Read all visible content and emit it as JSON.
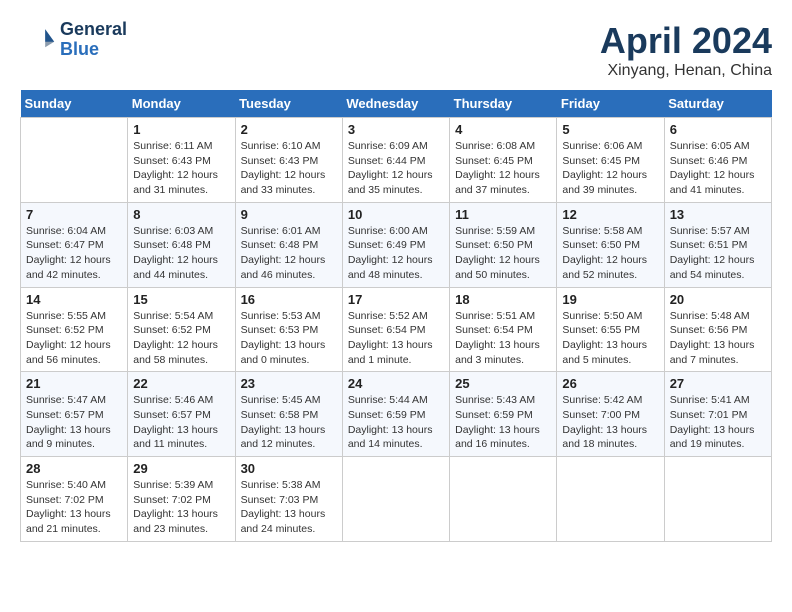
{
  "header": {
    "logo_line1": "General",
    "logo_line2": "Blue",
    "month": "April 2024",
    "location": "Xinyang, Henan, China"
  },
  "days_of_week": [
    "Sunday",
    "Monday",
    "Tuesday",
    "Wednesday",
    "Thursday",
    "Friday",
    "Saturday"
  ],
  "weeks": [
    [
      {
        "day": "",
        "sunrise": "",
        "sunset": "",
        "daylight": ""
      },
      {
        "day": "1",
        "sunrise": "Sunrise: 6:11 AM",
        "sunset": "Sunset: 6:43 PM",
        "daylight": "Daylight: 12 hours and 31 minutes."
      },
      {
        "day": "2",
        "sunrise": "Sunrise: 6:10 AM",
        "sunset": "Sunset: 6:43 PM",
        "daylight": "Daylight: 12 hours and 33 minutes."
      },
      {
        "day": "3",
        "sunrise": "Sunrise: 6:09 AM",
        "sunset": "Sunset: 6:44 PM",
        "daylight": "Daylight: 12 hours and 35 minutes."
      },
      {
        "day": "4",
        "sunrise": "Sunrise: 6:08 AM",
        "sunset": "Sunset: 6:45 PM",
        "daylight": "Daylight: 12 hours and 37 minutes."
      },
      {
        "day": "5",
        "sunrise": "Sunrise: 6:06 AM",
        "sunset": "Sunset: 6:45 PM",
        "daylight": "Daylight: 12 hours and 39 minutes."
      },
      {
        "day": "6",
        "sunrise": "Sunrise: 6:05 AM",
        "sunset": "Sunset: 6:46 PM",
        "daylight": "Daylight: 12 hours and 41 minutes."
      }
    ],
    [
      {
        "day": "7",
        "sunrise": "Sunrise: 6:04 AM",
        "sunset": "Sunset: 6:47 PM",
        "daylight": "Daylight: 12 hours and 42 minutes."
      },
      {
        "day": "8",
        "sunrise": "Sunrise: 6:03 AM",
        "sunset": "Sunset: 6:48 PM",
        "daylight": "Daylight: 12 hours and 44 minutes."
      },
      {
        "day": "9",
        "sunrise": "Sunrise: 6:01 AM",
        "sunset": "Sunset: 6:48 PM",
        "daylight": "Daylight: 12 hours and 46 minutes."
      },
      {
        "day": "10",
        "sunrise": "Sunrise: 6:00 AM",
        "sunset": "Sunset: 6:49 PM",
        "daylight": "Daylight: 12 hours and 48 minutes."
      },
      {
        "day": "11",
        "sunrise": "Sunrise: 5:59 AM",
        "sunset": "Sunset: 6:50 PM",
        "daylight": "Daylight: 12 hours and 50 minutes."
      },
      {
        "day": "12",
        "sunrise": "Sunrise: 5:58 AM",
        "sunset": "Sunset: 6:50 PM",
        "daylight": "Daylight: 12 hours and 52 minutes."
      },
      {
        "day": "13",
        "sunrise": "Sunrise: 5:57 AM",
        "sunset": "Sunset: 6:51 PM",
        "daylight": "Daylight: 12 hours and 54 minutes."
      }
    ],
    [
      {
        "day": "14",
        "sunrise": "Sunrise: 5:55 AM",
        "sunset": "Sunset: 6:52 PM",
        "daylight": "Daylight: 12 hours and 56 minutes."
      },
      {
        "day": "15",
        "sunrise": "Sunrise: 5:54 AM",
        "sunset": "Sunset: 6:52 PM",
        "daylight": "Daylight: 12 hours and 58 minutes."
      },
      {
        "day": "16",
        "sunrise": "Sunrise: 5:53 AM",
        "sunset": "Sunset: 6:53 PM",
        "daylight": "Daylight: 13 hours and 0 minutes."
      },
      {
        "day": "17",
        "sunrise": "Sunrise: 5:52 AM",
        "sunset": "Sunset: 6:54 PM",
        "daylight": "Daylight: 13 hours and 1 minute."
      },
      {
        "day": "18",
        "sunrise": "Sunrise: 5:51 AM",
        "sunset": "Sunset: 6:54 PM",
        "daylight": "Daylight: 13 hours and 3 minutes."
      },
      {
        "day": "19",
        "sunrise": "Sunrise: 5:50 AM",
        "sunset": "Sunset: 6:55 PM",
        "daylight": "Daylight: 13 hours and 5 minutes."
      },
      {
        "day": "20",
        "sunrise": "Sunrise: 5:48 AM",
        "sunset": "Sunset: 6:56 PM",
        "daylight": "Daylight: 13 hours and 7 minutes."
      }
    ],
    [
      {
        "day": "21",
        "sunrise": "Sunrise: 5:47 AM",
        "sunset": "Sunset: 6:57 PM",
        "daylight": "Daylight: 13 hours and 9 minutes."
      },
      {
        "day": "22",
        "sunrise": "Sunrise: 5:46 AM",
        "sunset": "Sunset: 6:57 PM",
        "daylight": "Daylight: 13 hours and 11 minutes."
      },
      {
        "day": "23",
        "sunrise": "Sunrise: 5:45 AM",
        "sunset": "Sunset: 6:58 PM",
        "daylight": "Daylight: 13 hours and 12 minutes."
      },
      {
        "day": "24",
        "sunrise": "Sunrise: 5:44 AM",
        "sunset": "Sunset: 6:59 PM",
        "daylight": "Daylight: 13 hours and 14 minutes."
      },
      {
        "day": "25",
        "sunrise": "Sunrise: 5:43 AM",
        "sunset": "Sunset: 6:59 PM",
        "daylight": "Daylight: 13 hours and 16 minutes."
      },
      {
        "day": "26",
        "sunrise": "Sunrise: 5:42 AM",
        "sunset": "Sunset: 7:00 PM",
        "daylight": "Daylight: 13 hours and 18 minutes."
      },
      {
        "day": "27",
        "sunrise": "Sunrise: 5:41 AM",
        "sunset": "Sunset: 7:01 PM",
        "daylight": "Daylight: 13 hours and 19 minutes."
      }
    ],
    [
      {
        "day": "28",
        "sunrise": "Sunrise: 5:40 AM",
        "sunset": "Sunset: 7:02 PM",
        "daylight": "Daylight: 13 hours and 21 minutes."
      },
      {
        "day": "29",
        "sunrise": "Sunrise: 5:39 AM",
        "sunset": "Sunset: 7:02 PM",
        "daylight": "Daylight: 13 hours and 23 minutes."
      },
      {
        "day": "30",
        "sunrise": "Sunrise: 5:38 AM",
        "sunset": "Sunset: 7:03 PM",
        "daylight": "Daylight: 13 hours and 24 minutes."
      },
      {
        "day": "",
        "sunrise": "",
        "sunset": "",
        "daylight": ""
      },
      {
        "day": "",
        "sunrise": "",
        "sunset": "",
        "daylight": ""
      },
      {
        "day": "",
        "sunrise": "",
        "sunset": "",
        "daylight": ""
      },
      {
        "day": "",
        "sunrise": "",
        "sunset": "",
        "daylight": ""
      }
    ]
  ]
}
